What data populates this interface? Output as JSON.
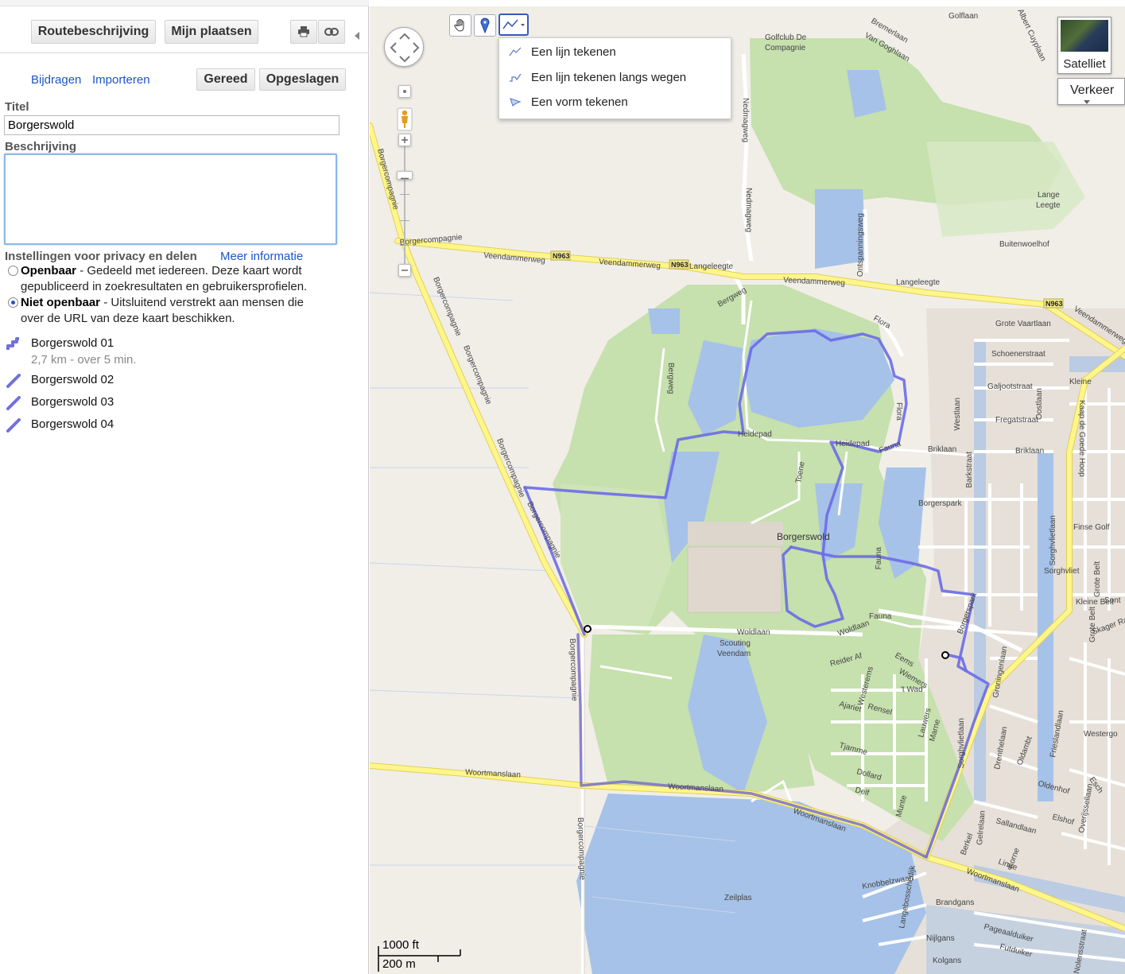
{
  "panel": {
    "buttons": {
      "directions": "Routebeschrijving",
      "my_places": "Mijn plaatsen"
    },
    "links": {
      "contribute": "Bijdragen",
      "import": "Importeren"
    },
    "actions": {
      "done": "Gereed",
      "saved": "Opgeslagen"
    },
    "title_label": "Titel",
    "title_value": "Borgerswold",
    "description_label": "Beschrijving",
    "description_value": "",
    "privacy": {
      "heading": "Instellingen voor privacy en delen",
      "more_info": "Meer informatie",
      "public_title": "Openbaar",
      "public_desc_1": " - Gedeeld met iedereen. Deze kaart wordt",
      "public_desc_2": "gepubliceerd in zoekresultaten en gebruikersprofielen.",
      "private_title": "Niet openbaar",
      "private_desc_1": " - Uitsluitend verstrekt aan mensen die",
      "private_desc_2": "over de URL van deze kaart beschikken.",
      "selected": "private"
    },
    "items": [
      {
        "name": "Borgerswold 01",
        "sub": "2,7 km - over 5 min.",
        "icon": "route-icon"
      },
      {
        "name": "Borgerswold 02",
        "icon": "line-icon"
      },
      {
        "name": "Borgerswold 03",
        "icon": "line-icon"
      },
      {
        "name": "Borgerswold 04",
        "icon": "line-icon"
      }
    ]
  },
  "map": {
    "draw_menu": {
      "line": "Een lijn tekenen",
      "line_roads": "Een lijn tekenen langs wegen",
      "shape": "Een vorm tekenen"
    },
    "satellite": "Satelliet",
    "traffic": "Verkeer",
    "scale_ft": "1000 ft",
    "scale_m": "200 m",
    "labels": {
      "golfclub_1": "Golfclub De",
      "golfclub_2": "Compagnie",
      "golflaan": "Golflaan",
      "bremerlaan": "Bremerlaan",
      "van_goghlaan": "Van Goghlaan",
      "albert_cuyplaan": "Albert Cuyplaan",
      "nedmagweg": "Nedmagweg",
      "nedmagweg2": "Nedmagweg",
      "ontspanningsweg": "Ontspanningsweg",
      "lange_leegte_1": "Lange",
      "lange_leegte_2": "Leegte",
      "buitenwoelhof": "Buitenwoelhof",
      "veendammerweg": "Veendammerweg",
      "veendammerweg2": "Veendammerweg",
      "veendammerweg3": "Veendammerweg",
      "veendammerweg4": "Veendammerweg",
      "langeleegte": "Langeleegte",
      "langeleegte2": "Langeleegte",
      "borgercompagnie": "Borgercompagnie",
      "borgercompagnie2": "Borgercompagnie",
      "borgercompagnie3": "Borgercompagnie",
      "borgercompagnie4": "Borgercompagnie",
      "borgercompagnie5": "Borgercompagnie",
      "borgercompagnie6": "Borgercompagnie",
      "borgercompagnie7": "Borgercompagnie",
      "bergweg": "Bergweg",
      "bergweg2": "Bergweg",
      "flora": "Flora",
      "flora2": "Flora",
      "heidepad": "Heidepad",
      "heidepad2": "Heidepad",
      "fauna": "Fauna",
      "fauna2": "Fauna",
      "fauna3": "Fauna",
      "briklaan": "Briklaan",
      "briklaan2": "Briklaan",
      "toene": "Toene",
      "borgerswold": "Borgerswold",
      "borgerspark": "Borgerspark",
      "borgerspark2": "Borgerspark",
      "grote_vaartlaan": "Grote Vaartlaan",
      "schoenerstraat": "Schoenerstraat",
      "galjootstraat": "Galjootstraat",
      "fregatstraat": "Fregatstraat",
      "westlaan": "Westlaan",
      "barkstraat": "Barkstraat",
      "oostlaan": "Oostlaan",
      "kleine_oost": "Kleine",
      "kaap": "Kaap de Goede Hoop",
      "sorghvlietlaan": "Sorghvlietlaan",
      "sorghvlietlaan2": "Sorghvlietlaan",
      "finse_golf": "Finse Golf",
      "grote_belt": "Grote Belt",
      "grote_belt2": "Grote Belt",
      "sorghvliet": "Sorghvliet",
      "sont": "Sont",
      "kleine_belt": "Kleine Belt",
      "skager_rak": "Skager Rak",
      "woldlaan": "Woldlaan",
      "woldlaan2": "Woldlaan",
      "scouting_1": "Scouting",
      "scouting_2": "Veendam",
      "reider_af": "Reider Af",
      "westeremsstraat": "Westerems",
      "eems": "Eems",
      "wiemers": "Wiemers",
      "t_wad": "'t Wad",
      "ajariet": "Ajariet",
      "rensel": "Rensel",
      "lauwers": "Lauwers",
      "marne": "Marne",
      "tjamme": "Tjamme",
      "dollard": "Dollard",
      "delf": "Delf",
      "munte": "Munte",
      "groningenlaan": "Groningenlaan",
      "drenthelaan": "Drenthelaan",
      "friesland": "Frieslandlaan",
      "westergo": "Westergo",
      "oldambt": "Oldambt",
      "oldenhof": "Oldenhof",
      "esch": "Esch",
      "overijssel": "Overijssellaan",
      "elshof": "Elshof",
      "gelrelaan": "Gelrelaan",
      "salland": "Sallandlaan",
      "berkel": "Berkel",
      "linge": "Linge",
      "korne": "Korne",
      "woortmanslaan": "Woortmanslaan",
      "woortmanslaan2": "Woortmanslaan",
      "woortmanslaan3": "Woortmanslaan",
      "woortmanslaan4": "Woortmanslaan",
      "knobbelzwaan": "Knobbelzwaan",
      "langebosschedijk": "Langebosschedijk",
      "brandgans": "Brandgans",
      "zeilplas": "Zeilplas",
      "nijlgans": "Nijlgans",
      "pageaalduiker": "Pageaalduiker",
      "futduiker": "Futduiker",
      "kolgans": "Kolgans",
      "nolensstraat": "Nolensstraat",
      "n963_1": "N963",
      "n963_2": "N963",
      "n963_3": "N963"
    }
  },
  "colors": {
    "route": "#6c6ce6",
    "route_dark": "#5555cc",
    "park": "#c6e0ae",
    "water": "#a6c2e8",
    "road_major": "#fff68a",
    "road_major_edge": "#e5d45a",
    "land": "#f1eee8",
    "built": "#e4ded6",
    "link": "#1a55c9"
  }
}
